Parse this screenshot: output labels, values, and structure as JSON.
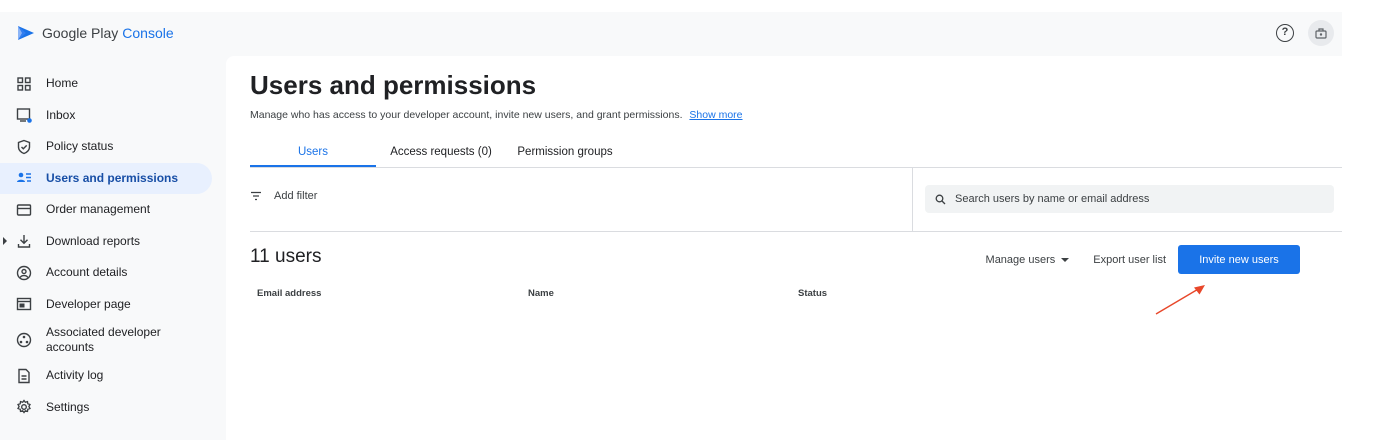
{
  "app": {
    "brand_google": "Google Play",
    "brand_console": "Console"
  },
  "topbar": {
    "help_icon": "help-circle-icon",
    "avatar_icon": "developer-account-icon"
  },
  "sidebar": {
    "items": [
      {
        "label": "Home",
        "icon": "grid-icon"
      },
      {
        "label": "Inbox",
        "icon": "inbox-icon"
      },
      {
        "label": "Policy status",
        "icon": "shield-check-icon"
      },
      {
        "label": "Users and permissions",
        "icon": "users-list-icon",
        "active": true
      },
      {
        "label": "Order management",
        "icon": "credit-card-icon"
      },
      {
        "label": "Download reports",
        "icon": "download-icon",
        "expandable": true
      },
      {
        "label": "Account details",
        "icon": "account-circle-icon"
      },
      {
        "label": "Developer page",
        "icon": "web-page-icon"
      },
      {
        "label": "Associated developer accounts",
        "icon": "connected-accounts-icon"
      },
      {
        "label": "Activity log",
        "icon": "document-icon"
      },
      {
        "label": "Settings",
        "icon": "gear-icon"
      }
    ]
  },
  "main": {
    "title": "Users and permissions",
    "description": "Manage who has access to your developer account, invite new users, and grant permissions.",
    "show_more": "Show more",
    "tabs": [
      {
        "label": "Users",
        "active": true
      },
      {
        "label": "Access requests (0)"
      },
      {
        "label": "Permission groups"
      }
    ],
    "filter_label": "Add filter",
    "search_placeholder": "Search users by name or email address",
    "users_count": "11 users",
    "manage_users": "Manage users",
    "export_user_list": "Export user list",
    "invite_new_users": "Invite new users",
    "columns": [
      "Email address",
      "Name",
      "Status"
    ]
  },
  "colors": {
    "accent": "#1a73e8",
    "active_nav_bg": "#e8f0fe",
    "annotation": "#e8472a"
  }
}
